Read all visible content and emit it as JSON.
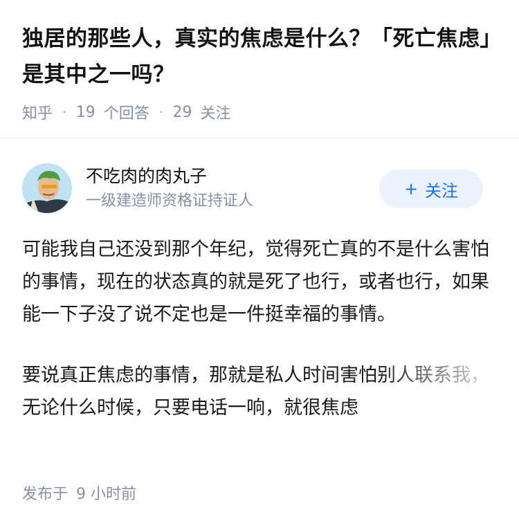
{
  "question": {
    "title": "独居的那些人，真实的焦虑是什么？「死亡焦虑」是其中之一吗？",
    "source": "知乎",
    "answer_count": "19",
    "answer_label": "个回答",
    "follower_count": "29",
    "follower_label": "关注"
  },
  "answer": {
    "author_name": "不吃肉的肉丸子",
    "author_bio": "一级建造师资格证持证人",
    "follow_plus": "+",
    "follow_label": "关注",
    "paragraphs": [
      "可能我自己还没到那个年纪，觉得死亡真的不是什么害怕的事情，现在的状态真的就是死了也行，或者也行，如果能一下子没了说不定也是一件挺幸福的事情。",
      "要说真正焦虑的事情，那就是私人时间害怕别人联系我，无论什么时候，只要电话一响，就很焦虑"
    ],
    "published_label": "发布于",
    "published_time": "9 小时前"
  },
  "colors": {
    "accent": "#1772f6",
    "follow_bg": "#ebf2fc",
    "meta_gray": "#8590a6"
  }
}
